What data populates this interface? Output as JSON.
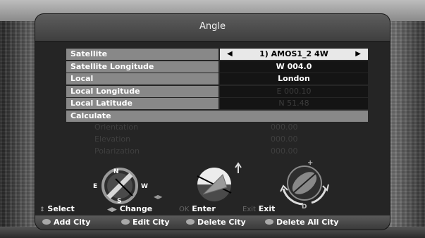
{
  "window": {
    "title": "Angle"
  },
  "settings": {
    "rows": [
      {
        "label": "Satellite",
        "value": "1) AMOS1_2 4W",
        "selected": true
      },
      {
        "label": "Satellite Longitude",
        "value": "W 004.0"
      },
      {
        "label": "Local",
        "value": "London"
      },
      {
        "label": "Local Longitude",
        "value": "E 000.10",
        "dim": true
      },
      {
        "label": "Local Latitude",
        "value": "N 51.48",
        "dim": true
      }
    ],
    "calculate_label": "Calculate",
    "arrow_left": "◀",
    "arrow_right": "▶"
  },
  "results": [
    {
      "label": "Orientation",
      "value": "000.00"
    },
    {
      "label": "Elevation",
      "value": "000.00"
    },
    {
      "label": "Polarization",
      "value": "000.00"
    }
  ],
  "compass": {
    "n": "N",
    "e": "E",
    "w": "W",
    "s": "S"
  },
  "polar": {
    "plus": "+",
    "d": "D"
  },
  "hints": {
    "select_key": "⇕",
    "select": "Select",
    "change_key": "◀▶",
    "change": "Change",
    "ok_key": "OK",
    "enter": "Enter",
    "exit_key": "Exit",
    "exit": "Exit"
  },
  "color_buttons": {
    "add_city": "Add City",
    "edit_city": "Edit City",
    "delete_city": "Delete City",
    "delete_all_city": "Delete All City"
  },
  "colors": {
    "panel": "#252525",
    "label_bar": "#888888",
    "value_bar": "#141414",
    "selected_value": "#e8e8e8"
  }
}
